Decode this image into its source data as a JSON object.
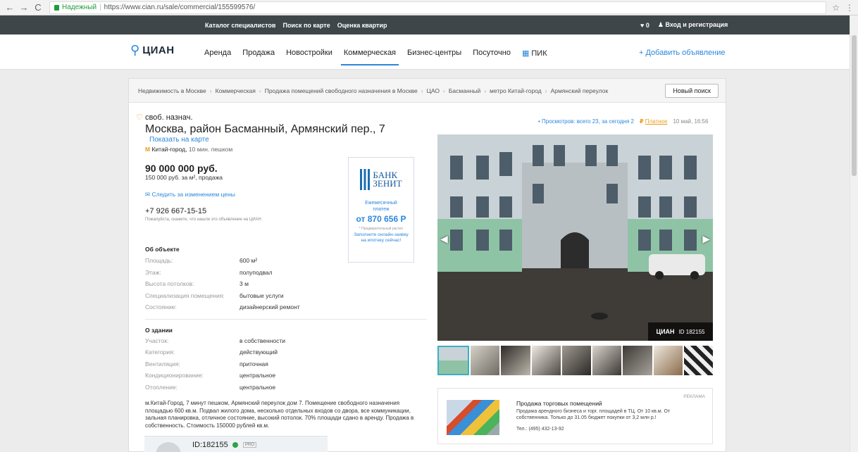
{
  "browser": {
    "secure_label": "Надежный",
    "url": "https://www.cian.ru/sale/commercial/155599576/"
  },
  "topbar": {
    "links": [
      "Каталог специалистов",
      "Поиск по карте",
      "Оценка квартир"
    ],
    "favorites_count": "0",
    "login": "Вход и регистрация"
  },
  "nav": {
    "logo": "ЦИАН",
    "items": [
      "Аренда",
      "Продажа",
      "Новостройки",
      "Коммерческая",
      "Бизнес-центры",
      "Посуточно",
      "ПИК"
    ],
    "active_index": 3,
    "add_listing": "+ Добавить объявление"
  },
  "breadcrumbs": [
    "Недвижимость в Москве",
    "Коммерческая",
    "Продажа помещений свободного назначения в Москве",
    "ЦАО",
    "Басманный",
    "метро Китай-город",
    "Армянский переулок"
  ],
  "new_search": "Новый поиск",
  "listing": {
    "kind": "своб. назнач.",
    "address": "Москва, район Басманный, Армянский пер., 7",
    "map_link": "Показать на карте",
    "metro": "Китай-город,",
    "metro_walk": "10 мин. пешком",
    "price": "90 000 000 руб.",
    "price_sub": "150 000 руб. за м², продажа",
    "watch_price": "Следить за изменением цены",
    "phone": "+7 926 667-15-15",
    "phone_note": "Пожалуйста, скажите, что нашли это объявление на ЦИАН",
    "views": "• Просмотров: всего 23, за сегодня 2",
    "paid": "Платное",
    "date": "10 май, 16:56"
  },
  "object": {
    "title": "Об объекте",
    "rows": [
      {
        "k": "Площадь:",
        "v": "600 м²"
      },
      {
        "k": "Этаж:",
        "v": "полуподвал"
      },
      {
        "k": "Высота потолков:",
        "v": "3 м"
      },
      {
        "k": "Специализация помещения:",
        "v": "бытовые услуги"
      },
      {
        "k": "Состояние:",
        "v": "дизайнерский ремонт"
      }
    ]
  },
  "building": {
    "title": "О здании",
    "rows": [
      {
        "k": "Участок:",
        "v": "в собственности"
      },
      {
        "k": "Категория:",
        "v": "действующий"
      },
      {
        "k": "Вентиляция:",
        "v": "приточная"
      },
      {
        "k": "Кондиционирование:",
        "v": "центральное"
      },
      {
        "k": "Отопление:",
        "v": "центральное"
      }
    ]
  },
  "description": "м.Китай-Город, 7 минут пешком, Армянский переулок дом 7. Помещение свободного назначения площадью 600 кв.м. Подвал жилого дома, несколько отдельных входов со двора, все коммуникации, зальная планировка, отличное состояние, высокий потолок. 70% площади сдано в аренду. Продажа в собственность. Стоимость 150000 рублей кв.м.",
  "bank_ad": {
    "name_line1": "БАНК",
    "name_line2": "ЗЕНИТ",
    "monthly_line1": "Ежемесячный",
    "monthly_line2": "платеж",
    "amount": "от 870 656 Р",
    "note": "* Предварительный расчет",
    "cta": "Заполните онлайн-заявку на ипотеку сейчас!"
  },
  "photo": {
    "badge_logo": "ЦИАН",
    "badge_id": "ID 182155"
  },
  "promo": {
    "tag": "РЕКЛАМА",
    "title": "Продажа торговых помещений",
    "text": "Продажа арендного бизнеса и торг. площадей в ТЦ. От 10 кв.м. От собственника. Только до 31.05 бюджет покупки от 3,2 млн р.!",
    "phone": "Тел.: (495) 432-13-92"
  },
  "agent": {
    "id": "ID:182155",
    "pro": "PRO"
  }
}
